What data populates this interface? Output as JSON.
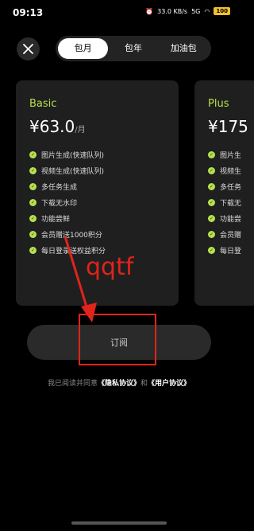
{
  "status": {
    "time": "09:13",
    "net_speed": "33.0 KB/s",
    "net_type": "5G",
    "battery": "100"
  },
  "tabs": [
    {
      "label": "包月",
      "active": true
    },
    {
      "label": "包年",
      "active": false
    },
    {
      "label": "加油包",
      "active": false
    }
  ],
  "plans": {
    "basic": {
      "name": "Basic",
      "price": "¥63.0",
      "unit": "/月",
      "features": [
        "图片生成(快速队列)",
        "视频生成(快速队列)",
        "多任务生成",
        "下载无水印",
        "功能尝鲜",
        "会员赠送1000积分",
        "每日登录送权益积分"
      ]
    },
    "plus": {
      "name": "Plus",
      "price": "¥175",
      "features": [
        "图片生",
        "视频生",
        "多任务",
        "下载无",
        "功能尝",
        "会员赠",
        "每日登"
      ]
    }
  },
  "subscribe_label": "订阅",
  "annotation_text": "qqtf",
  "agreement": {
    "prefix": "我已阅读并同意",
    "privacy": "《隐私协议》",
    "and": "和",
    "user": "《用户协议》"
  },
  "colors": {
    "accent": "#b5e14d",
    "annotation": "#e0241b",
    "card": "#1f1f1f"
  }
}
